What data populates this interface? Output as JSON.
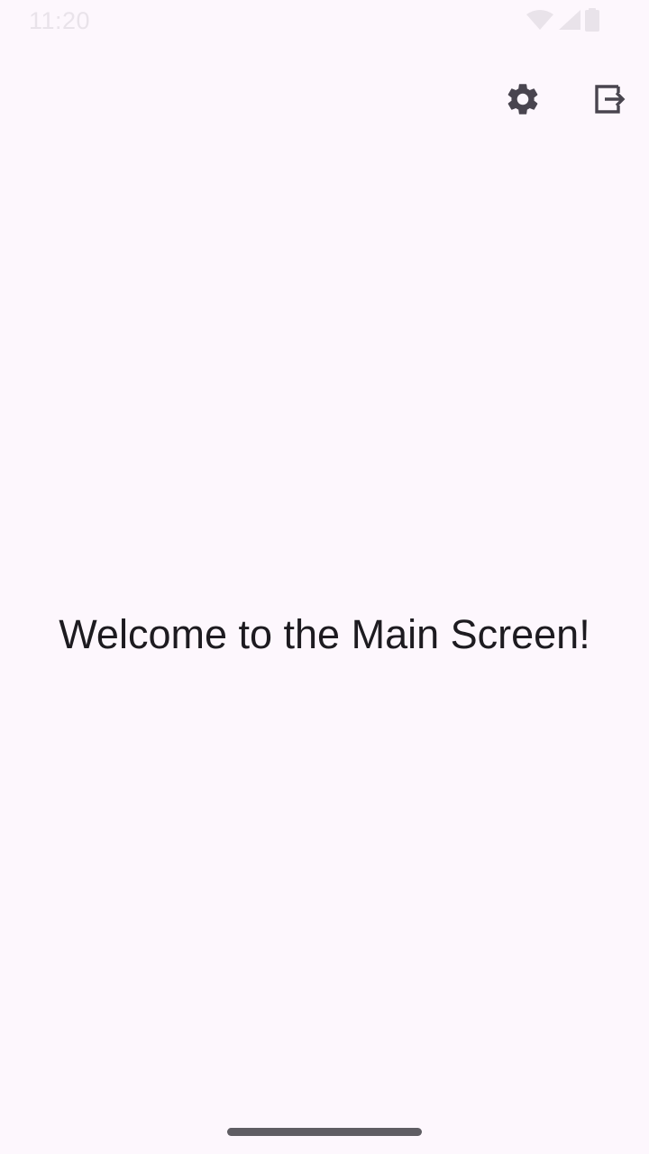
{
  "colors": {
    "background": "#fdf7fd",
    "status_bar_faint": "#e9e3ea",
    "icon": "#49454f",
    "text": "#1d1b20",
    "home_indicator": "#5f5d63"
  },
  "status_bar": {
    "time": "11:20",
    "icons": [
      "wifi-icon",
      "cellular-signal-icon",
      "battery-icon"
    ]
  },
  "top_bar": {
    "actions": [
      {
        "icon": "gear-icon",
        "name": "settings-button"
      },
      {
        "icon": "logout-icon",
        "name": "logout-button"
      }
    ]
  },
  "main": {
    "welcome_text": "Welcome to the Main Screen!"
  }
}
